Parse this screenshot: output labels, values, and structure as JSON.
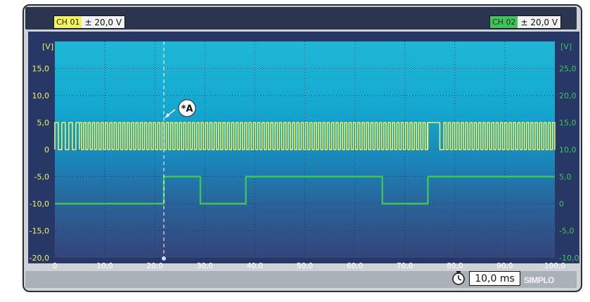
{
  "channels": {
    "ch1": {
      "tag": "CH 01",
      "range": "± 20,0 V",
      "color": "#f2f25a"
    },
    "ch2": {
      "tag": "CH 02",
      "range": "± 20,0 V",
      "color": "#3ec45a"
    }
  },
  "timebase": "10,0 ms",
  "logo": "SIMPLO",
  "cursor_label": "*A",
  "chart_data": {
    "type": "line",
    "x_ticks": [
      "0",
      "10,0",
      "20,0",
      "30,0",
      "40,0",
      "50,0",
      "60,0",
      "70,0",
      "80,0",
      "90,0",
      "100,0"
    ],
    "xlim": [
      0,
      100
    ],
    "left_axis": {
      "unit": "[V]",
      "ticks": [
        "15,0",
        "10,0",
        "5,0",
        "0",
        "-5,0",
        "-10,0",
        "-15,0",
        "-20,0"
      ],
      "ylim": [
        -20,
        20
      ]
    },
    "right_axis": {
      "unit": "[V]",
      "ticks": [
        "25,0",
        "20,0",
        "15,0",
        "10,0",
        "5,0",
        "0",
        "-5,0",
        "-10,0"
      ],
      "ylim": [
        -10,
        30
      ]
    },
    "cursor_x": 21.8,
    "grid": true,
    "series": [
      {
        "channel": "CH 01",
        "axis": "left",
        "color": "#f2f25a",
        "low": 0,
        "high": 5,
        "segments": [
          {
            "from": 0,
            "to": 4.9,
            "period": 1.4,
            "duty": 0.5,
            "start_high": true
          },
          {
            "from": 4.9,
            "to": 74.6,
            "period": 0.87,
            "duty": 0.5,
            "start_high": true
          },
          {
            "from": 74.6,
            "to": 77.8,
            "period": 3.2,
            "duty": 0.75,
            "start_high": true
          },
          {
            "from": 77.8,
            "to": 100,
            "period": 0.87,
            "duty": 0.5,
            "start_high": true
          }
        ],
        "gaps_low": [
          [
            76.4,
            77.8
          ],
          [
            74.1,
            74.6
          ]
        ]
      },
      {
        "channel": "CH 02",
        "axis": "right",
        "color": "#3ec45a",
        "points": [
          [
            0,
            0
          ],
          [
            21.8,
            0
          ],
          [
            21.8,
            5
          ],
          [
            29.1,
            5
          ],
          [
            29.1,
            0
          ],
          [
            38.2,
            0
          ],
          [
            38.2,
            5
          ],
          [
            65.5,
            5
          ],
          [
            65.5,
            0
          ],
          [
            74.6,
            0
          ],
          [
            74.6,
            5
          ],
          [
            100,
            5
          ]
        ]
      }
    ]
  }
}
